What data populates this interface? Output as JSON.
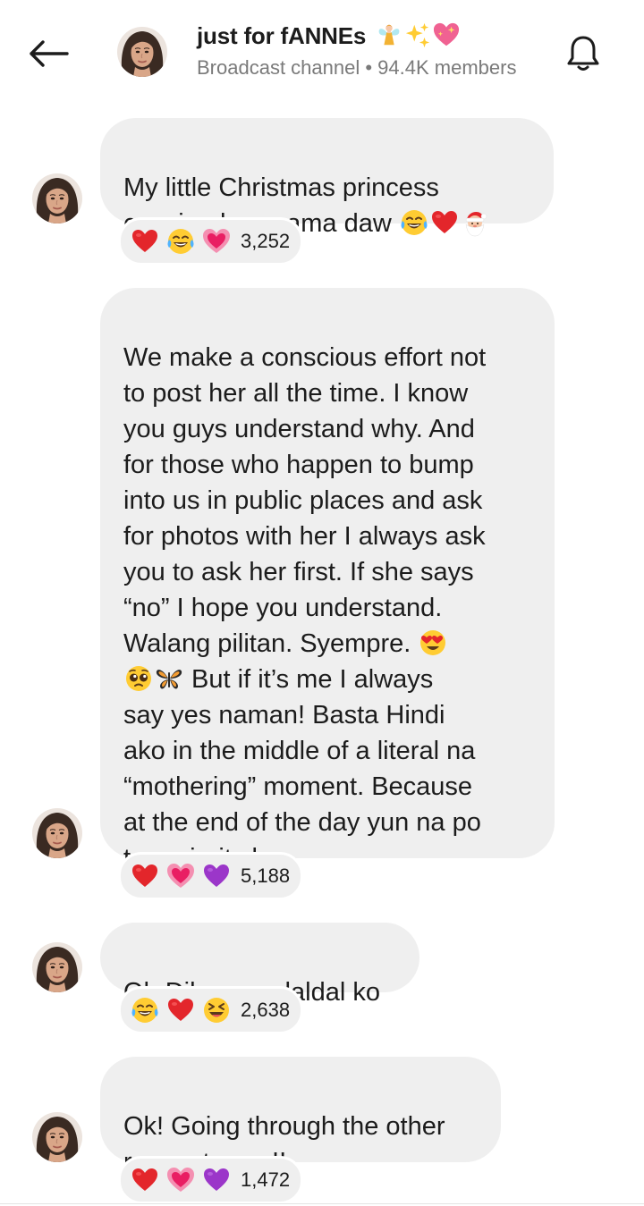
{
  "header": {
    "title": "just for fANNEs",
    "title_emojis": [
      "fairy",
      "sparkles",
      "sparkling-heart"
    ],
    "subtitle": "Broadcast channel • 94.4K members"
  },
  "messages": [
    {
      "text_parts": [
        "My little Christmas princess\ncopying her mama daw "
      ],
      "inline_emojis": [
        "joy",
        "red-heart",
        "santa"
      ],
      "reactions": [
        "red-heart",
        "joy",
        "growing-heart"
      ],
      "reaction_count": "3,252"
    },
    {
      "text_part1": "We make a conscious effort not\nto post her all the time. I know\nyou guys understand why. And\nfor those who happen to bump\ninto us in public places and ask\nfor photos with her I always ask\nyou to ask her first. If she says\n“no” I hope you understand.\nWalang pilitan. Syempre. ",
      "text_part2": " But if it’s me I always\nsay yes naman! Basta Hindi\nako in the middle of a literal na\n“mothering” moment. Because\nat the end of the day yun na po\ntop priority ko.",
      "inline_emojis": [
        "heart-eyes",
        "pleading-face",
        "butterfly"
      ],
      "reactions": [
        "red-heart",
        "growing-heart",
        "purple-heart"
      ],
      "reaction_count": "5,188"
    },
    {
      "text": "Oh Diba ang daldal ko",
      "reactions": [
        "joy",
        "red-heart",
        "laughing"
      ],
      "reaction_count": "2,638"
    },
    {
      "text": "Ok! Going through the other\nrequests nyo!!",
      "reactions": [
        "red-heart",
        "growing-heart",
        "purple-heart"
      ],
      "reaction_count": "1,472"
    }
  ],
  "colors": {
    "bubble": "#efefef",
    "subtitle": "#7a7a7a",
    "text": "#1c1c1c"
  }
}
